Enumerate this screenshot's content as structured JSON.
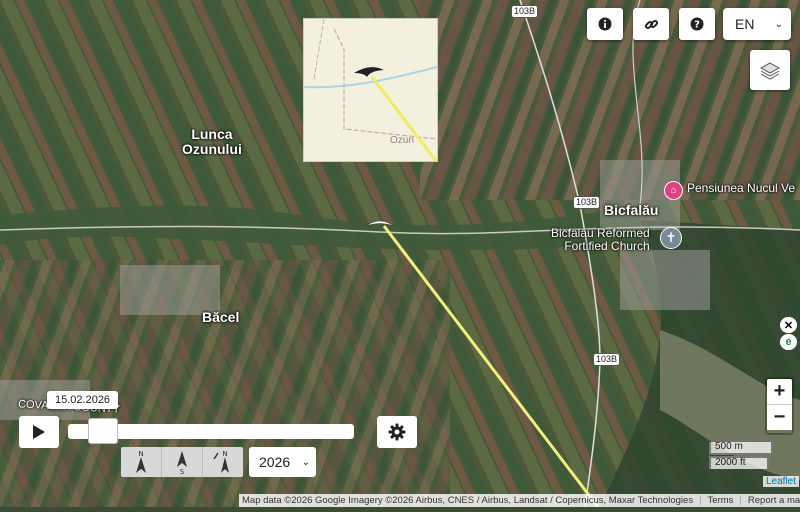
{
  "map": {
    "places": [
      {
        "id": "lunca-ozunului",
        "text": "Lunca\nOzunului"
      },
      {
        "id": "bacel",
        "text": "Băcel"
      },
      {
        "id": "bicfalau",
        "text": "Bicfalău"
      },
      {
        "id": "covasna",
        "text": "COVASNA COUNTY"
      }
    ],
    "poi_guesthouse": "Pensiunea Nucul Ve",
    "poi_church_line1": "Bicfalau Reformed",
    "poi_church_line2": "Fortified Church",
    "roads": [
      "103B",
      "103B",
      "103B"
    ],
    "minimap_label": "Ozun",
    "track_color": "#f2f07a"
  },
  "controls": {
    "info_icon": "info-circle-icon",
    "link_icon": "link-icon",
    "help_icon": "question-circle-icon",
    "language": "EN",
    "layers_icon": "layers-icon",
    "zoom_in": "+",
    "zoom_out": "−"
  },
  "timeline": {
    "date": "15.02.2026",
    "year": "2026",
    "progress": 0.08,
    "play_icon": "play-icon",
    "settings_icon": "gear-icon",
    "view_modes": [
      "N",
      "S",
      "N"
    ]
  },
  "scale": {
    "metric": "500 m",
    "imperial": "2000 ft"
  },
  "attribution": {
    "text": "Map data ©2026 Google Imagery ©2026 Airbus, CNES / Airbus, Landsat / Copernicus, Maxar Technologies",
    "terms": "Terms",
    "report": "Report a map error",
    "leaflet": "Leaflet"
  }
}
